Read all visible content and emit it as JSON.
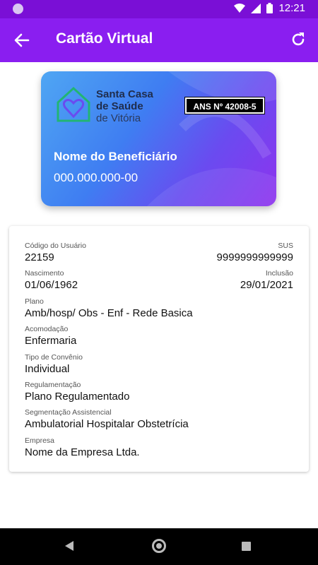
{
  "status_bar": {
    "time": "12:21"
  },
  "app_bar": {
    "title": "Cartão Virtual"
  },
  "card": {
    "brand_line1": "Santa Casa",
    "brand_line2": "de Saúde",
    "brand_line3": "de Vitória",
    "ans": "ANS Nº 42008-5",
    "beneficiary_name": "Nome do Beneficiário",
    "document": "000.000.000-00"
  },
  "details": {
    "user_code_label": "Código do Usuário",
    "user_code": "22159",
    "sus_label": "SUS",
    "sus": "9999999999999",
    "birth_label": "Nascimento",
    "birth": "01/06/1962",
    "inclusion_label": "Inclusão",
    "inclusion": "29/01/2021",
    "plan_label": "Plano",
    "plan": "Amb/hosp/ Obs - Enf - Rede Basica",
    "accommodation_label": "Acomodação",
    "accommodation": "Enfermaria",
    "agreement_type_label": "Tipo de Convênio",
    "agreement_type": "Individual",
    "regulation_label": "Regulamentação",
    "regulation": "Plano Regulamentado",
    "segmentation_label": "Segmentação Assistencial",
    "segmentation": "Ambulatorial Hospitalar Obstetrícia",
    "company_label": "Empresa",
    "company": "Nome da Empresa Ltda."
  },
  "colors": {
    "status_bar": "#7a0fd6",
    "app_bar": "#8a1ef0"
  },
  "icons": [
    "wifi-icon",
    "signal-icon",
    "battery-icon",
    "back-arrow-icon",
    "refresh-icon",
    "nav-back-icon",
    "nav-home-icon",
    "nav-recent-icon"
  ]
}
